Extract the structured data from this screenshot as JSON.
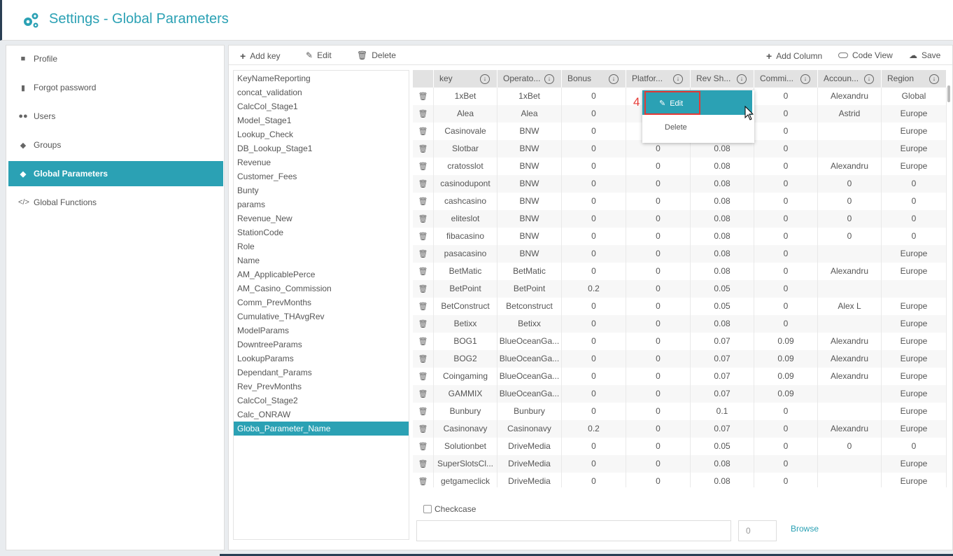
{
  "header": {
    "title": "Settings - Global Parameters",
    "icon": "gears-icon"
  },
  "sidebar": {
    "items": [
      {
        "label": "Profile",
        "icon": "user-icon"
      },
      {
        "label": "Forgot password",
        "icon": "lock-icon"
      },
      {
        "label": "Users",
        "icon": "users-icon"
      },
      {
        "label": "Groups",
        "icon": "tags-icon"
      },
      {
        "label": "Global Parameters",
        "icon": "tag-icon",
        "active": true
      },
      {
        "label": "Global Functions",
        "icon": "code-icon"
      }
    ]
  },
  "toolbar": {
    "add_key": "Add key",
    "edit": "Edit",
    "delete": "Delete",
    "add_column": "Add Column",
    "code_view": "Code View",
    "save": "Save"
  },
  "keys": [
    "KeyNameReporting",
    "concat_validation",
    "CalcCol_Stage1",
    "Model_Stage1",
    "Lookup_Check",
    "DB_Lookup_Stage1",
    "Revenue",
    "Customer_Fees",
    "Bunty",
    "params",
    "Revenue_New",
    "StationCode",
    "Role",
    "Name",
    "AM_ApplicablePerce",
    "AM_Casino_Commission",
    "Comm_PrevMonths",
    "Cumulative_THAvgRev",
    "ModelParams",
    "DowntreeParams",
    "LookupParams",
    "Dependant_Params",
    "Rev_PrevMonths",
    "CalcCol_Stage2",
    "Calc_ONRAW",
    "Globa_Parameter_Name"
  ],
  "active_key": "Globa_Parameter_Name",
  "table": {
    "columns": [
      "key",
      "Operato...",
      "Bonus",
      "Platfor...",
      "Rev Sh...",
      "Commi...",
      "Accoun...",
      "Region"
    ],
    "rows": [
      [
        "1xBet",
        "1xBet",
        "0",
        "",
        "",
        "0",
        "Alexandru",
        "Global"
      ],
      [
        "Alea",
        "Alea",
        "0",
        "",
        "",
        "0",
        "Astrid",
        "Europe"
      ],
      [
        "Casinovale",
        "BNW",
        "0",
        "",
        "",
        "0",
        "",
        "Europe"
      ],
      [
        "Slotbar",
        "BNW",
        "0",
        "0",
        "0.08",
        "0",
        "",
        "Europe"
      ],
      [
        "cratosslot",
        "BNW",
        "0",
        "0",
        "0.08",
        "0",
        "Alexandru",
        "Europe"
      ],
      [
        "casinodupont",
        "BNW",
        "0",
        "0",
        "0.08",
        "0",
        "0",
        "0"
      ],
      [
        "cashcasino",
        "BNW",
        "0",
        "0",
        "0.08",
        "0",
        "0",
        "0"
      ],
      [
        "eliteslot",
        "BNW",
        "0",
        "0",
        "0.08",
        "0",
        "0",
        "0"
      ],
      [
        "fibacasino",
        "BNW",
        "0",
        "0",
        "0.08",
        "0",
        "0",
        "0"
      ],
      [
        "pasacasino",
        "BNW",
        "0",
        "0",
        "0.08",
        "0",
        "",
        "Europe"
      ],
      [
        "BetMatic",
        "BetMatic",
        "0",
        "0",
        "0.08",
        "0",
        "Alexandru",
        "Europe"
      ],
      [
        "BetPoint",
        "BetPoint",
        "0.2",
        "0",
        "0.05",
        "0",
        "",
        ""
      ],
      [
        "BetConstruct",
        "Betconstruct",
        "0",
        "0",
        "0.05",
        "0",
        "Alex L",
        "Europe"
      ],
      [
        "Betixx",
        "Betixx",
        "0",
        "0",
        "0.08",
        "0",
        "",
        "Europe"
      ],
      [
        "BOG1",
        "BlueOceanGa...",
        "0",
        "0",
        "0.07",
        "0.09",
        "Alexandru",
        "Europe"
      ],
      [
        "BOG2",
        "BlueOceanGa...",
        "0",
        "0",
        "0.07",
        "0.09",
        "Alexandru",
        "Europe"
      ],
      [
        "Coingaming",
        "BlueOceanGa...",
        "0",
        "0",
        "0.07",
        "0.09",
        "Alexandru",
        "Europe"
      ],
      [
        "GAMMIX",
        "BlueOceanGa...",
        "0",
        "0",
        "0.07",
        "0.09",
        "",
        "Europe"
      ],
      [
        "Bunbury",
        "Bunbury",
        "0",
        "0",
        "0.1",
        "0",
        "",
        "Europe"
      ],
      [
        "Casinonavy",
        "Casinonavy",
        "0.2",
        "0",
        "0.07",
        "0",
        "Alexandru",
        "Europe"
      ],
      [
        "Solutionbet",
        "DriveMedia",
        "0",
        "0",
        "0.05",
        "0",
        "0",
        "0"
      ],
      [
        "SuperSlotsCl...",
        "DriveMedia",
        "0",
        "0",
        "0.08",
        "0",
        "",
        "Europe"
      ],
      [
        "getgameclick",
        "DriveMedia",
        "0",
        "0",
        "0.08",
        "0",
        "",
        "Europe"
      ]
    ]
  },
  "context_menu": {
    "edit": "Edit",
    "delete": "Delete",
    "step_marker": "4"
  },
  "footer": {
    "checkcase": "Checkcase",
    "number_value": "0",
    "browse": "Browse"
  },
  "colors": {
    "accent": "#2ba1b4",
    "highlight": "#e53935"
  }
}
